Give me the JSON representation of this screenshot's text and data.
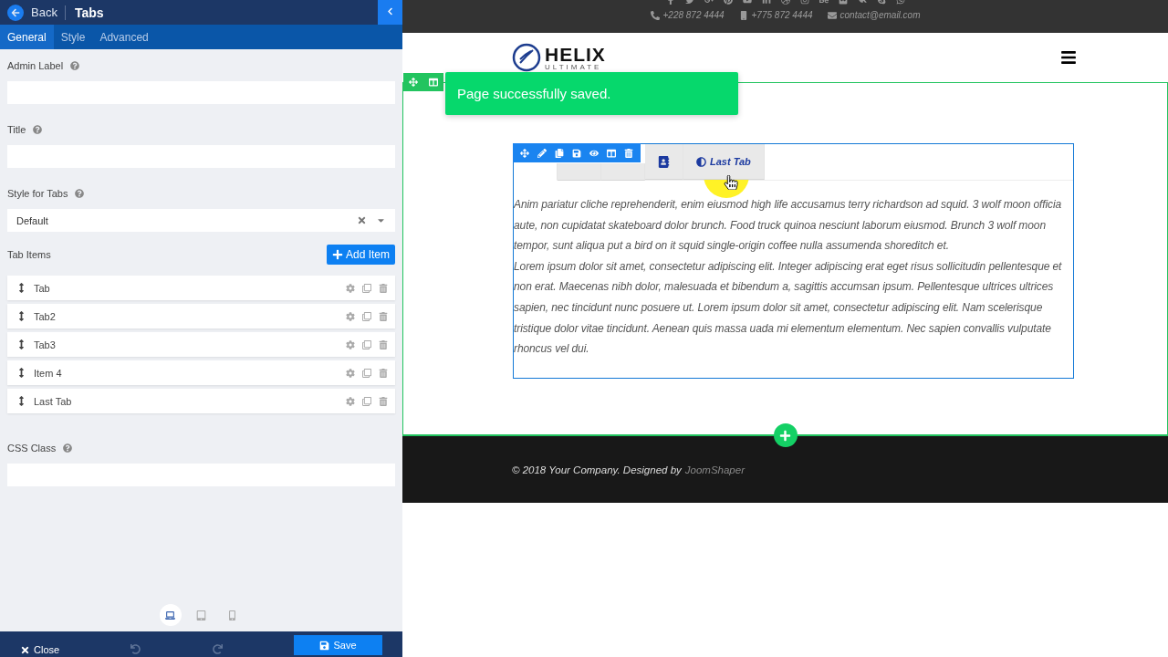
{
  "panel": {
    "back": "Back",
    "title": "Tabs",
    "tabs": [
      {
        "label": "General",
        "selected": true
      },
      {
        "label": "Style",
        "selected": false
      },
      {
        "label": "Advanced",
        "selected": false
      }
    ],
    "admin_label": {
      "label": "Admin Label"
    },
    "title_field": {
      "label": "Title"
    },
    "style_for_tabs": {
      "label": "Style for Tabs",
      "value": "Default"
    },
    "tab_items": {
      "label": "Tab Items",
      "add_button": "Add Item",
      "items": [
        {
          "name": "Tab"
        },
        {
          "name": "Tab2"
        },
        {
          "name": "Tab3"
        },
        {
          "name": "Item 4"
        },
        {
          "name": "Last Tab"
        }
      ]
    },
    "css_class": {
      "label": "CSS Class"
    },
    "devices": [
      {
        "kind": "desktop",
        "selected": true
      },
      {
        "kind": "tablet",
        "selected": false
      },
      {
        "kind": "phone",
        "selected": false
      }
    ],
    "footer": {
      "close": "Close",
      "save": "Save"
    }
  },
  "site": {
    "contacts": [
      {
        "kind": "phone",
        "text": "+228 872 4444"
      },
      {
        "kind": "mobile",
        "text": "+775 872 4444"
      },
      {
        "kind": "email",
        "text": "contact@email.com"
      }
    ],
    "logo": {
      "name": "HELIX",
      "sub": "ULTIMATE"
    },
    "toast": "Page successfully saved.",
    "tabs": [
      {
        "selected": true
      },
      {
        "selected": false
      },
      {
        "selected": false
      },
      {
        "kind": "icon",
        "selected": false
      },
      {
        "kind": "icon-label",
        "label": "Last Tab",
        "selected": false
      }
    ],
    "paragraphs": [
      "Anim pariatur cliche reprehenderit, enim eiusmod high life accusamus terry richardson ad squid. 3 wolf moon officia aute, non cupidatat skateboard dolor brunch. Food truck quinoa nesciunt laborum eiusmod. Brunch 3 wolf moon tempor, sunt aliqua put a bird on it squid single-origin coffee nulla assumenda shoreditch et.",
      "Lorem ipsum dolor sit amet, consectetur adipiscing elit. Integer adipiscing erat eget risus sollicitudin pellentesque et non erat. Maecenas nibh dolor, malesuada et bibendum a, sagittis accumsan ipsum. Pellentesque ultrices ultrices sapien, nec tincidunt nunc posuere ut. Lorem ipsum dolor sit amet, consectetur adipiscing elit. Nam scelerisque tristique dolor vitae tincidunt. Aenean quis massa uada mi elementum elementum. Nec sapien convallis vulputate rhoncus vel dui."
    ],
    "copyright": "© 2018 Your Company. Designed by",
    "designer_link": "JoomShaper"
  }
}
